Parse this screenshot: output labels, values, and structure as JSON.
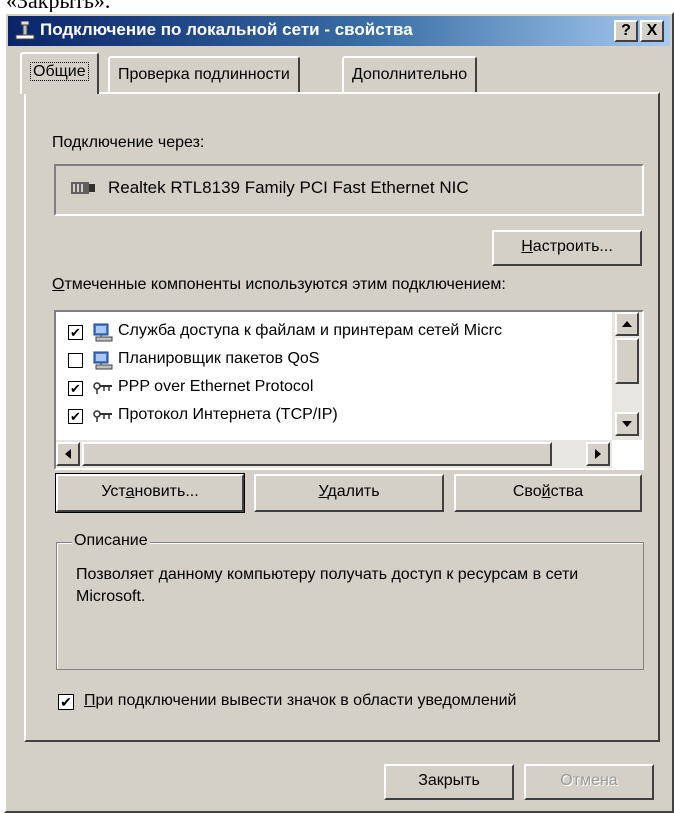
{
  "caption_fragment": "«Закрыть».",
  "window": {
    "title": "Подключение по локальной сети - свойства",
    "help_label": "?",
    "close_label": "X"
  },
  "tabs": [
    {
      "label": "Общие",
      "active": true
    },
    {
      "label": "Проверка подлинности",
      "active": false
    },
    {
      "label": "Дополнительно",
      "active": false
    }
  ],
  "connect_using": {
    "label": "Подключение через:",
    "adapter": "Realtek RTL8139 Family PCI Fast Ethernet NIC",
    "configure_prefix": "",
    "configure_hotkey": "Н",
    "configure_rest": "астроить..."
  },
  "components": {
    "label_hotkey": "О",
    "label_rest": "тмеченные компоненты используются этим подключением:",
    "items": [
      {
        "label": "Служба доступа к файлам и принтерам сетей Micrc",
        "checked": true,
        "icon": "network-computer-icon"
      },
      {
        "label": "Планировщик пакетов QoS",
        "checked": false,
        "icon": "network-computer-icon"
      },
      {
        "label": "PPP over Ethernet Protocol",
        "checked": true,
        "icon": "protocol-icon"
      },
      {
        "label": "Протокол Интернета (TCP/IP)",
        "checked": true,
        "icon": "protocol-icon"
      }
    ]
  },
  "buttons": {
    "install_prefix": "Уст",
    "install_hotkey": "а",
    "install_rest": "новить...",
    "remove_hotkey": "У",
    "remove_rest": "далить",
    "properties_prefix": "Сво",
    "properties_hotkey": "й",
    "properties_rest": "ства"
  },
  "description": {
    "legend": "Описание",
    "text": "Позволяет данному компьютеру получать доступ к ресурсам в сети Microsoft."
  },
  "notify": {
    "checked": true,
    "label_hotkey": "П",
    "label_rest": "ри подключении вывести значок в области уведомлений"
  },
  "footer": {
    "close_label": "Закрыть",
    "cancel_label": "Отмена"
  },
  "colors": {
    "titlebar_start": "#0a246a",
    "titlebar_end": "#a6caf0",
    "face": "#d4d0c8"
  }
}
